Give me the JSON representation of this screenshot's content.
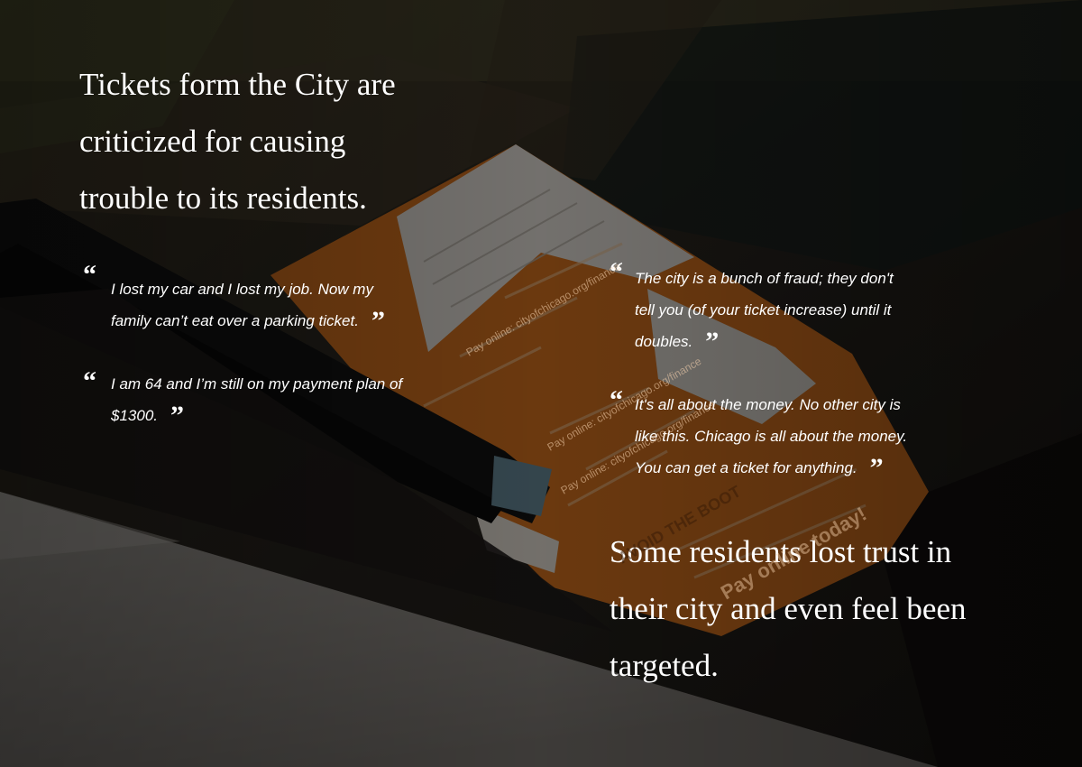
{
  "headline_top": {
    "lines": [
      "Tickets form the City are",
      "criticized for causing",
      "trouble to its residents."
    ]
  },
  "headline_bottom": {
    "lines": [
      "Some residents lost trust in",
      "their city and even feel been",
      "targeted."
    ]
  },
  "quote_marks": {
    "open": "“",
    "close": "”"
  },
  "quotes": [
    {
      "lines": [
        "I lost my car and I lost my job. Now my",
        "family can’t eat over a parking ticket."
      ]
    },
    {
      "lines": [
        "I am 64 and I’m still on my payment plan of",
        "$1300."
      ]
    },
    {
      "lines": [
        "The city is a bunch of fraud; they don't",
        "tell you (of your ticket increase) until it",
        "doubles."
      ]
    },
    {
      "lines": [
        "It's all about the money. No other city is",
        "like this. Chicago is all about the money.",
        "You can get a ticket for anything."
      ]
    }
  ],
  "ticket": {
    "repeated_text": "Pay online: cityofchicago.org/finance",
    "banner_text": "AVOID THE BOOT",
    "promo_text": "Pay online today!"
  },
  "colors": {
    "ticket_orange": "#d9741f",
    "text": "#ffffff",
    "overlay": "#000000"
  }
}
